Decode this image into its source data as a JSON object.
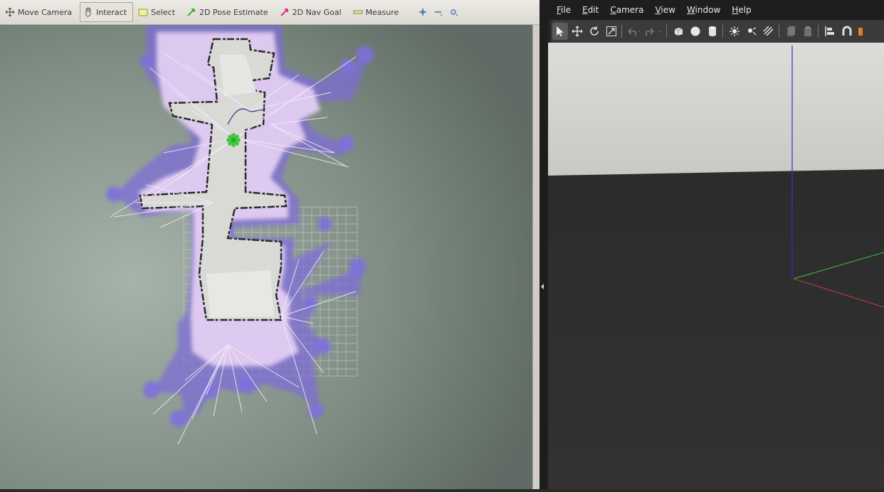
{
  "rviz": {
    "toolbar": {
      "tools": [
        {
          "label": "Move Camera",
          "icon": "move-camera-icon"
        },
        {
          "label": "Interact",
          "icon": "hand-icon"
        },
        {
          "label": "Select",
          "icon": "select-icon"
        },
        {
          "label": "2D Pose Estimate",
          "icon": "green-arrow-icon"
        },
        {
          "label": "2D Nav Goal",
          "icon": "pink-arrow-icon"
        },
        {
          "label": "Measure",
          "icon": "ruler-icon"
        }
      ],
      "extra_icons": [
        "focus-icon",
        "minus-icon",
        "target-icon"
      ],
      "active_tool": "Interact"
    },
    "colors": {
      "background": "#7f8d84",
      "map_free": "#dcdcdc",
      "costmap": "#8470d8",
      "inflation": "#e0c8f0",
      "robot": "#3ad53a",
      "grid": "#c9ccd2"
    }
  },
  "gazebo": {
    "menu": {
      "items": [
        "File",
        "Edit",
        "Camera",
        "View",
        "Window",
        "Help"
      ],
      "mnemonics": [
        "F",
        "E",
        "C",
        "V",
        "W",
        "H"
      ]
    },
    "toolbar_icons": [
      "select-arrow-icon",
      "translate-icon",
      "rotate-icon",
      "scale-icon",
      "undo-icon",
      "redo-icon",
      "box-icon",
      "sphere-icon",
      "cylinder-icon",
      "point-light-icon",
      "spot-light-icon",
      "directional-light-icon",
      "copy-icon",
      "paste-icon",
      "align-icon",
      "snap-icon"
    ],
    "colors": {
      "sky": "#d7d7d4",
      "ground": "#2e2e2e",
      "z_axis": "#3030e0",
      "y_axis": "#40c040",
      "x_axis": "#c04040"
    }
  }
}
